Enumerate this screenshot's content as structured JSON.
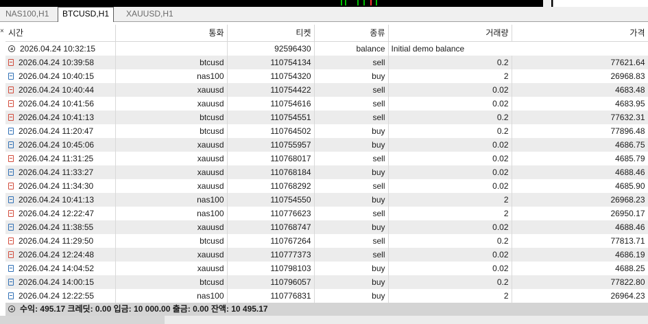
{
  "tabs": [
    {
      "label": "NAS100,H1"
    },
    {
      "label": "BTCUSD,H1"
    },
    {
      "label": "XAUUSD,H1"
    }
  ],
  "active_tab": 1,
  "columns": {
    "time": "시간",
    "symbol": "통화",
    "ticket": "티켓",
    "type": "종류",
    "volume": "거래량",
    "price": "가격"
  },
  "balance_row": {
    "time": "2026.04.24 10:32:15",
    "ticket": "92596430",
    "type": "balance",
    "comment": "Initial demo balance",
    "icon": "plus-circle-icon"
  },
  "deals": [
    {
      "time": "2026.04.24 10:39:58",
      "symbol": "btcusd",
      "ticket": "110754134",
      "type": "sell",
      "volume": "0.2",
      "price": "77621.64"
    },
    {
      "time": "2026.04.24 10:40:15",
      "symbol": "nas100",
      "ticket": "110754320",
      "type": "buy",
      "volume": "2",
      "price": "26968.83"
    },
    {
      "time": "2026.04.24 10:40:44",
      "symbol": "xauusd",
      "ticket": "110754422",
      "type": "sell",
      "volume": "0.02",
      "price": "4683.48"
    },
    {
      "time": "2026.04.24 10:41:56",
      "symbol": "xauusd",
      "ticket": "110754616",
      "type": "sell",
      "volume": "0.02",
      "price": "4683.95"
    },
    {
      "time": "2026.04.24 10:41:13",
      "symbol": "btcusd",
      "ticket": "110754551",
      "type": "sell",
      "volume": "0.2",
      "price": "77632.31"
    },
    {
      "time": "2026.04.24 11:20:47",
      "symbol": "btcusd",
      "ticket": "110764502",
      "type": "buy",
      "volume": "0.2",
      "price": "77896.48"
    },
    {
      "time": "2026.04.24 10:45:06",
      "symbol": "xauusd",
      "ticket": "110755957",
      "type": "buy",
      "volume": "0.02",
      "price": "4686.75"
    },
    {
      "time": "2026.04.24 11:31:25",
      "symbol": "xauusd",
      "ticket": "110768017",
      "type": "sell",
      "volume": "0.02",
      "price": "4685.79"
    },
    {
      "time": "2026.04.24 11:33:27",
      "symbol": "xauusd",
      "ticket": "110768184",
      "type": "buy",
      "volume": "0.02",
      "price": "4688.46"
    },
    {
      "time": "2026.04.24 11:34:30",
      "symbol": "xauusd",
      "ticket": "110768292",
      "type": "sell",
      "volume": "0.02",
      "price": "4685.90"
    },
    {
      "time": "2026.04.24 10:41:13",
      "symbol": "nas100",
      "ticket": "110754550",
      "type": "buy",
      "volume": "2",
      "price": "26968.23"
    },
    {
      "time": "2026.04.24 12:22:47",
      "symbol": "nas100",
      "ticket": "110776623",
      "type": "sell",
      "volume": "2",
      "price": "26950.17"
    },
    {
      "time": "2026.04.24 11:38:55",
      "symbol": "xauusd",
      "ticket": "110768747",
      "type": "buy",
      "volume": "0.02",
      "price": "4688.46"
    },
    {
      "time": "2026.04.24 11:29:50",
      "symbol": "btcusd",
      "ticket": "110767264",
      "type": "sell",
      "volume": "0.2",
      "price": "77813.71"
    },
    {
      "time": "2026.04.24 12:24:48",
      "symbol": "xauusd",
      "ticket": "110777373",
      "type": "sell",
      "volume": "0.02",
      "price": "4686.19"
    },
    {
      "time": "2026.04.24 14:04:52",
      "symbol": "xauusd",
      "ticket": "110798103",
      "type": "buy",
      "volume": "0.02",
      "price": "4688.25"
    },
    {
      "time": "2026.04.24 14:00:15",
      "symbol": "btcusd",
      "ticket": "110796057",
      "type": "buy",
      "volume": "0.2",
      "price": "77822.80"
    },
    {
      "time": "2026.04.24 12:22:55",
      "symbol": "nas100",
      "ticket": "110776831",
      "type": "buy",
      "volume": "2",
      "price": "26964.23"
    }
  ],
  "footer": {
    "icon": "plus-circle-icon",
    "text": "수익: 495.17  크레딧: 0.00  입금: 10 000.00  출금: 0.00  잔액: 10 495.17"
  },
  "colors": {
    "sell_icon": "#d24a3a",
    "buy_icon": "#2e6fb5",
    "row_alt": "#ececec",
    "footer_bg": "#d4d4d4"
  },
  "close_glyph": "×"
}
